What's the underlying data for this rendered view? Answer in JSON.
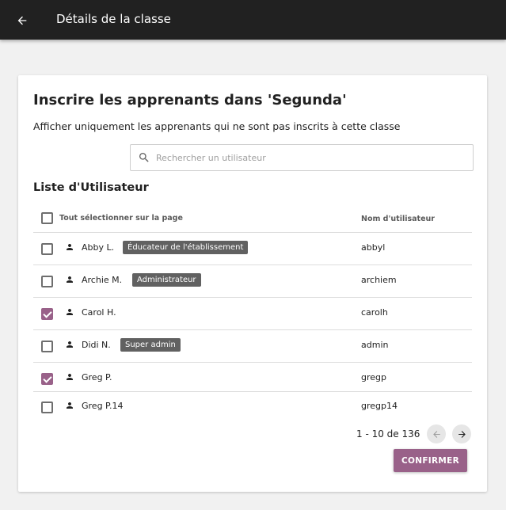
{
  "appbar": {
    "title": "Détails de la classe",
    "back_icon": "arrow-back-icon"
  },
  "card": {
    "title": "Inscrire les apprenants dans 'Segunda'",
    "filter_text": "Afficher uniquement les apprenants qui ne sont pas inscrits à cette classe",
    "search": {
      "placeholder": "Rechercher un utilisateur",
      "value": ""
    },
    "list_title": "Liste d'Utilisateur",
    "table": {
      "select_all_label": "Tout sélectionner sur la page",
      "username_header": "Nom d'utilisateur",
      "rows": [
        {
          "name": "Abby L.",
          "role": "Éducateur de l'établissement",
          "username": "abbyl",
          "checked": false
        },
        {
          "name": "Archie M.",
          "role": "Administrateur",
          "username": "archiem",
          "checked": false
        },
        {
          "name": "Carol H.",
          "role": "",
          "username": "carolh",
          "checked": true
        },
        {
          "name": "Didi N.",
          "role": "Super admin",
          "username": "admin",
          "checked": false
        },
        {
          "name": "Greg P.",
          "role": "",
          "username": "gregp",
          "checked": true
        },
        {
          "name": "Greg P.14",
          "role": "",
          "username": "gregp14",
          "checked": false
        }
      ]
    },
    "pagination": {
      "text": "1 - 10 de 136",
      "prev_icon": "arrow-left-icon",
      "next_icon": "arrow-right-icon"
    },
    "confirm_label": "CONFIRMER"
  },
  "colors": {
    "appbar": "#212121",
    "accent": "#996189",
    "badge": "#616161"
  }
}
